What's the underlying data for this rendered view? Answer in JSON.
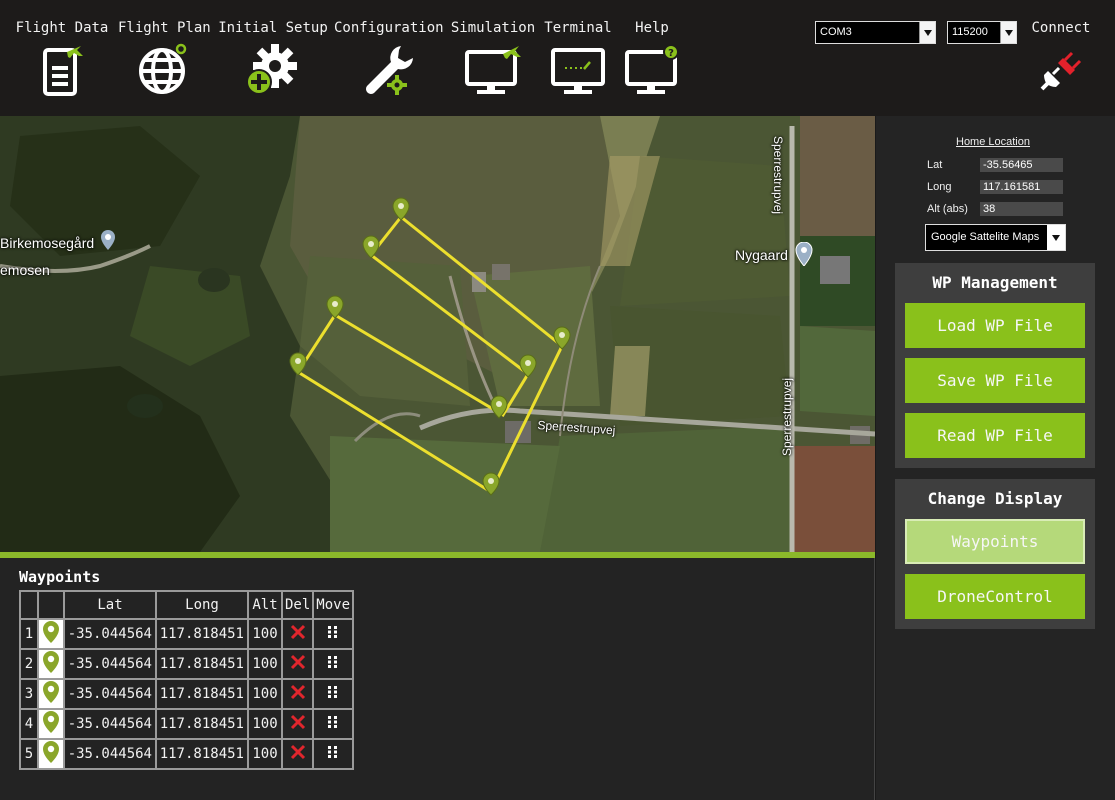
{
  "toolbar": {
    "tools": [
      {
        "label": "Flight Data",
        "icon": "flight-data-icon"
      },
      {
        "label": "Flight Plan",
        "icon": "globe-icon"
      },
      {
        "label": "Initial Setup",
        "icon": "setup-gears-icon"
      },
      {
        "label": "Configuration",
        "icon": "wrench-gear-icon"
      },
      {
        "label": "Simulation",
        "icon": "monitor-plane-icon"
      },
      {
        "label": "Terminal",
        "icon": "monitor-terminal-icon"
      },
      {
        "label": "Help",
        "icon": "monitor-help-icon"
      }
    ],
    "port": "COM3",
    "baud": "115200",
    "connect_label": "Connect"
  },
  "map": {
    "labels": {
      "birkemosegard": "Birkemosegård",
      "emosen": "emosen",
      "nygaard": "Nygaard",
      "sperrestrupvej": "Sperrestrupvej",
      "sperrestrupvej_vertical_top": "Sperrestrupvej",
      "sperrestrupvej_vertical_bottom": "Sperrestrupvej"
    }
  },
  "waypoints": {
    "title": "Waypoints",
    "headers": [
      "",
      "",
      "Lat",
      "Long",
      "Alt",
      "Del",
      "Move"
    ],
    "rows": [
      {
        "num": "1",
        "lat": "-35.044564",
        "long": "117.818451",
        "alt": "100"
      },
      {
        "num": "2",
        "lat": "-35.044564",
        "long": "117.818451",
        "alt": "100"
      },
      {
        "num": "3",
        "lat": "-35.044564",
        "long": "117.818451",
        "alt": "100"
      },
      {
        "num": "4",
        "lat": "-35.044564",
        "long": "117.818451",
        "alt": "100"
      },
      {
        "num": "5",
        "lat": "-35.044564",
        "long": "117.818451",
        "alt": "100"
      }
    ]
  },
  "home": {
    "title": "Home Location",
    "lat_label": "Lat",
    "lat": "-35.56465",
    "long_label": "Long",
    "long": "117.161581",
    "alt_label": "Alt (abs)",
    "alt": "38",
    "map_type": "Google Sattelite Maps"
  },
  "wp_management": {
    "title": "WP Management",
    "load": "Load WP File",
    "save": "Save WP File",
    "read": "Read WP File"
  },
  "change_display": {
    "title": "Change Display",
    "waypoints": "Waypoints",
    "drone_control": "DroneControl"
  },
  "colors": {
    "accent": "#8ac11b",
    "route": "#ecdf2e",
    "marker": "#8aa62a"
  }
}
